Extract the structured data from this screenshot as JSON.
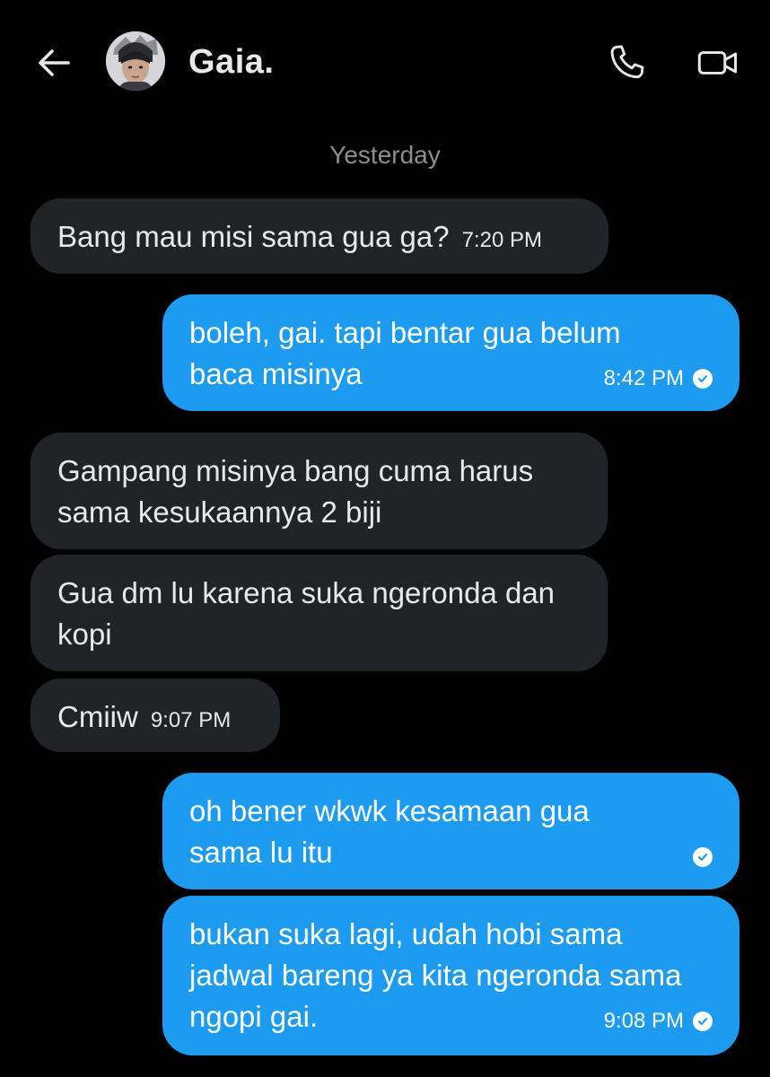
{
  "header": {
    "contact_name": "Gaia.",
    "back_icon": "arrow-left-icon",
    "call_icon": "phone-icon",
    "video_icon": "video-camera-icon"
  },
  "date_separator": "Yesterday",
  "colors": {
    "background": "#000000",
    "incoming_bubble": "#202327",
    "outgoing_bubble": "#1d9bf0",
    "muted_text": "#8b8f94"
  },
  "messages": [
    {
      "direction": "incoming",
      "text": "Bang mau misi sama gua ga?",
      "time": "7:20 PM"
    },
    {
      "direction": "outgoing",
      "text": "boleh, gai. tapi bentar gua belum baca misinya",
      "time": "8:42 PM",
      "status_icon": "check-circle-icon"
    },
    {
      "direction": "incoming",
      "text": "Gampang misinya bang cuma harus sama kesukaannya 2 biji",
      "time": ""
    },
    {
      "direction": "incoming",
      "text": "Gua dm lu karena suka ngeronda dan kopi",
      "time": ""
    },
    {
      "direction": "incoming",
      "text": "Cmiiw",
      "time": "9:07 PM"
    },
    {
      "direction": "outgoing",
      "text": "oh bener wkwk kesamaan gua sama lu itu",
      "time": "",
      "status_icon": "check-circle-icon"
    },
    {
      "direction": "outgoing",
      "text": "bukan suka lagi, udah hobi sama jadwal bareng ya kita ngeronda sama ngopi gai.",
      "time": "9:08 PM",
      "status_icon": "check-circle-icon"
    }
  ]
}
